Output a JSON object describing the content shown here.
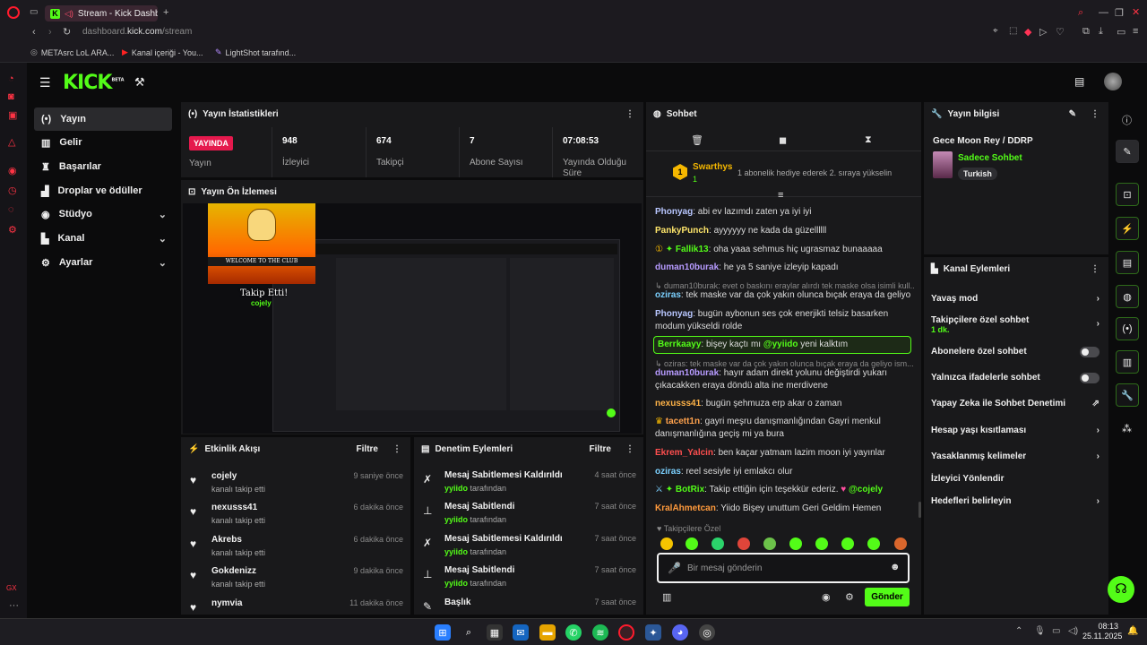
{
  "browser": {
    "tab_title": "Stream - Kick Dashboard",
    "url_prefix": "dashboard.",
    "url_domain": "kick.com",
    "url_path": "/stream",
    "bookmarks": [
      "METAsrc LoL ARA...",
      "Kanal içeriği - You...",
      "LightShot tarafınd..."
    ]
  },
  "app": {
    "logo": "KICK",
    "logo_badge": "BETA"
  },
  "sidebar": {
    "items": [
      {
        "label": "Yayın",
        "icon": "broadcast-icon"
      },
      {
        "label": "Gelir",
        "icon": "chart-icon"
      },
      {
        "label": "Başarılar",
        "icon": "trophy-icon"
      },
      {
        "label": "Droplar ve ödüller",
        "icon": "gift-icon"
      },
      {
        "label": "Stüdyo",
        "icon": "studio-icon"
      },
      {
        "label": "Kanal",
        "icon": "channel-icon"
      },
      {
        "label": "Ayarlar",
        "icon": "gear-icon"
      }
    ]
  },
  "stats": {
    "title": "Yayın İstatistikleri",
    "live_badge": "YAYINDA",
    "live_label": "Yayın",
    "viewers": "948",
    "viewers_label": "İzleyici",
    "followers": "674",
    "followers_label": "Takipçi",
    "subs": "7",
    "subs_label": "Abone Sayısı",
    "uptime": "07:08:53",
    "uptime_label": "Yayında Olduğu Süre"
  },
  "preview": {
    "title": "Yayın Ön İzlemesi",
    "overlay_text": "Takip Etti!",
    "overlay_user": "cojely",
    "overlay_banner": "WELCOME TO THE CLUB"
  },
  "activity": {
    "title": "Etkinlik Akışı",
    "filter": "Filtre",
    "items": [
      {
        "name": "cojely",
        "sub": "kanalı takip etti",
        "time": "9 saniye önce"
      },
      {
        "name": "nexusss41",
        "sub": "kanalı takip etti",
        "time": "6 dakika önce"
      },
      {
        "name": "Akrebs",
        "sub": "kanalı takip etti",
        "time": "6 dakika önce"
      },
      {
        "name": "Gokdenizz",
        "sub": "kanalı takip etti",
        "time": "9 dakika önce"
      },
      {
        "name": "nymvia",
        "sub": "",
        "time": "11 dakika önce"
      }
    ]
  },
  "moderation": {
    "title": "Denetim Eylemleri",
    "filter": "Filtre",
    "items": [
      {
        "action": "Mesaj Sabitlemesi Kaldırıldı",
        "by": "yyiido",
        "suffix": "tarafından",
        "time": "4 saat önce"
      },
      {
        "action": "Mesaj Sabitlendi",
        "by": "yyiido",
        "suffix": "tarafından",
        "time": "7 saat önce"
      },
      {
        "action": "Mesaj Sabitlemesi Kaldırıldı",
        "by": "yyiido",
        "suffix": "tarafından",
        "time": "7 saat önce"
      },
      {
        "action": "Mesaj Sabitlendi",
        "by": "yyiido",
        "suffix": "tarafından",
        "time": "7 saat önce"
      },
      {
        "action": "Başlık",
        "by": "",
        "suffix": "",
        "time": "7 saat önce"
      }
    ]
  },
  "chat": {
    "title": "Sohbet",
    "gift_user": "Swarthys",
    "gift_count": "1",
    "gift_text": "1 abonelik hediye ederek 2. sıraya yükselin",
    "messages": [
      {
        "user": "Phonyag",
        "color": "#b9c7ff",
        "text": "abi ev lazımdı zaten ya iyi iyi"
      },
      {
        "user": "PankyPunch",
        "color": "#ffe66b",
        "text": "ayyyyyy ne kada da güzellllll"
      },
      {
        "user": "Fallik13",
        "color": "#53fc18",
        "text": "oha yaaa sehmus hiç ugrasmaz bunaaaaa"
      },
      {
        "user": "duman10burak",
        "color": "#b79bff",
        "text": "he ya 5 saniye izleyip kapadı"
      },
      {
        "system": "duman10burak: evet o baskını eraylar alırdı tek maske olsa isimli kull..."
      },
      {
        "user": "oziras",
        "color": "#7cd1ff",
        "text": "tek maske var da çok yakın olunca bıçak eraya da geliyo"
      },
      {
        "user": "Phonyag",
        "color": "#b9c7ff",
        "text": "bugün aybonun ses çok enerjikti telsiz basarken modum yükseldi rolde"
      },
      {
        "user": "Berrkaayy",
        "color": "#53fc18",
        "text": "bişey kaçtı mı",
        "mention": "@yyiido",
        "tail": "yeni kalktım"
      },
      {
        "system": "oziras: tek maske var da çok yakın olunca bıçak eraya da geliyo ism..."
      },
      {
        "user": "duman10burak",
        "color": "#b79bff",
        "text": "hayır adam direkt yolunu değiştirdi yukarı çıkacakken eraya döndü alta ine merdivene"
      },
      {
        "user": "nexusss41",
        "color": "#ffb347",
        "text": "bugün şehmuza erp akar o zaman"
      },
      {
        "user": "tacett1n",
        "color": "#ffa24d",
        "text": "gayri meşru danışmanlığından Gayri menkul danışmanlığına geçiş mi ya bura"
      },
      {
        "user": "Ekrem_Yalcin",
        "color": "#ff4f4f",
        "text": "ben kaçar yatmam lazim moon iyi yayınlar"
      },
      {
        "user": "oziras",
        "color": "#7cd1ff",
        "text": "reel sesiyle iyi emlakcı olur"
      },
      {
        "user": "BotRix",
        "color": "#53fc18",
        "text": "Takip ettiğin için teşekkür ederiz.",
        "mention": "@cojely"
      },
      {
        "user": "KralAhmetcan",
        "color": "#ff9a3c",
        "text": "Yiido Bişey unuttum Geri Geldim Hemen"
      }
    ],
    "followers_only": "Takipçilere Özel",
    "input_placeholder": "Bir mesaj gönderin",
    "send": "Gönder"
  },
  "stream_info": {
    "title": "Yayın bilgisi",
    "stream_title": "Gece Moon Rey / DDRP",
    "category": "Sadece Sohbet",
    "tag": "Turkish"
  },
  "channel_actions": {
    "title": "Kanal Eylemleri",
    "items": [
      {
        "label": "Yavaş mod",
        "type": "chevron"
      },
      {
        "label": "Takipçilere özel sohbet",
        "type": "chevron",
        "sub": "1 dk."
      },
      {
        "label": "Abonelere özel sohbet",
        "type": "toggle"
      },
      {
        "label": "Yalnızca ifadelerle sohbet",
        "type": "toggle"
      },
      {
        "label": "Yapay Zeka ile Sohbet Denetimi",
        "type": "external"
      },
      {
        "label": "Hesap yaşı kısıtlaması",
        "type": "chevron"
      },
      {
        "label": "Yasaklanmış kelimeler",
        "type": "chevron"
      },
      {
        "label": "İzleyici Yönlendir",
        "type": "none"
      },
      {
        "label": "Hedefleri belirleyin",
        "type": "chevron"
      }
    ]
  },
  "taskbar": {
    "time": "08:13",
    "date": "25.11.2025"
  },
  "colors": {
    "accent": "#53fc18",
    "live": "#e5194d",
    "panel": "#19191b"
  }
}
